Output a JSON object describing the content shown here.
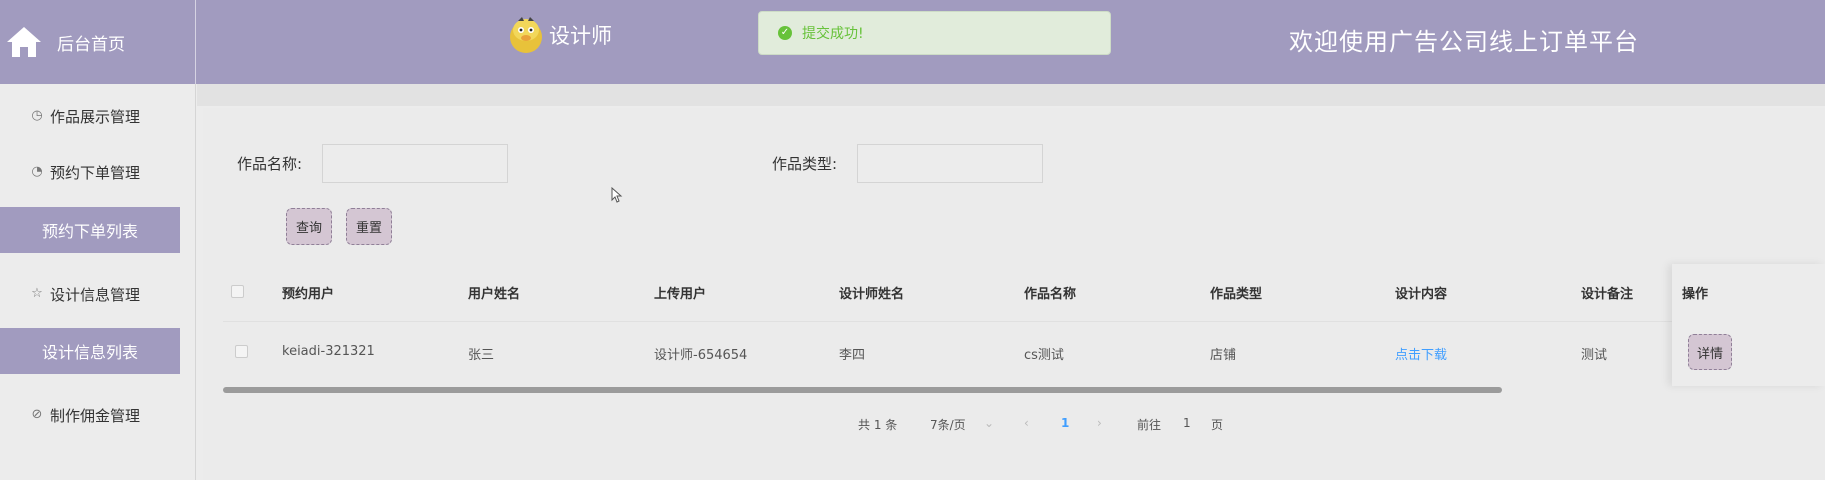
{
  "header": {
    "home_label": "后台首页",
    "role_label": "设计师",
    "welcome": "欢迎使用广告公司线上订单平台"
  },
  "toast": {
    "message": "提交成功!",
    "status_color": "#67c23a"
  },
  "sidebar": {
    "items": [
      {
        "label": "作品展示管理",
        "icon": "clock-icon"
      },
      {
        "label": "预约下单管理",
        "icon": "pie-icon"
      },
      {
        "label": "预约下单列表",
        "active": true
      },
      {
        "label": "设计信息管理",
        "icon": "star-icon"
      },
      {
        "label": "设计信息列表",
        "active": true
      },
      {
        "label": "制作佣金管理",
        "icon": "compass-icon"
      }
    ]
  },
  "search": {
    "name_label": "作品名称:",
    "name_value": "",
    "type_label": "作品类型:",
    "type_value": "",
    "query_button": "查询",
    "reset_button": "重置"
  },
  "table": {
    "columns": [
      "预约用户",
      "用户姓名",
      "上传用户",
      "设计师姓名",
      "作品名称",
      "作品类型",
      "设计内容",
      "设计备注",
      "操作"
    ],
    "rows": [
      {
        "booking_user": "keiadi-321321",
        "user_name": "张三",
        "upload_user": "设计师-654654",
        "designer_name": "李四",
        "work_name": "cs测试",
        "work_type": "店铺",
        "design_content": "点击下载",
        "design_note": "测试",
        "action": "详情"
      }
    ]
  },
  "pagination": {
    "total": "共 1 条",
    "page_size": "7条/页",
    "current_page": "1",
    "goto_prefix": "前往",
    "goto_value": "1",
    "goto_suffix": "页"
  },
  "colors": {
    "accent": "#a19bbf",
    "link": "#409eff",
    "button_bg": "#d4c6d3"
  }
}
